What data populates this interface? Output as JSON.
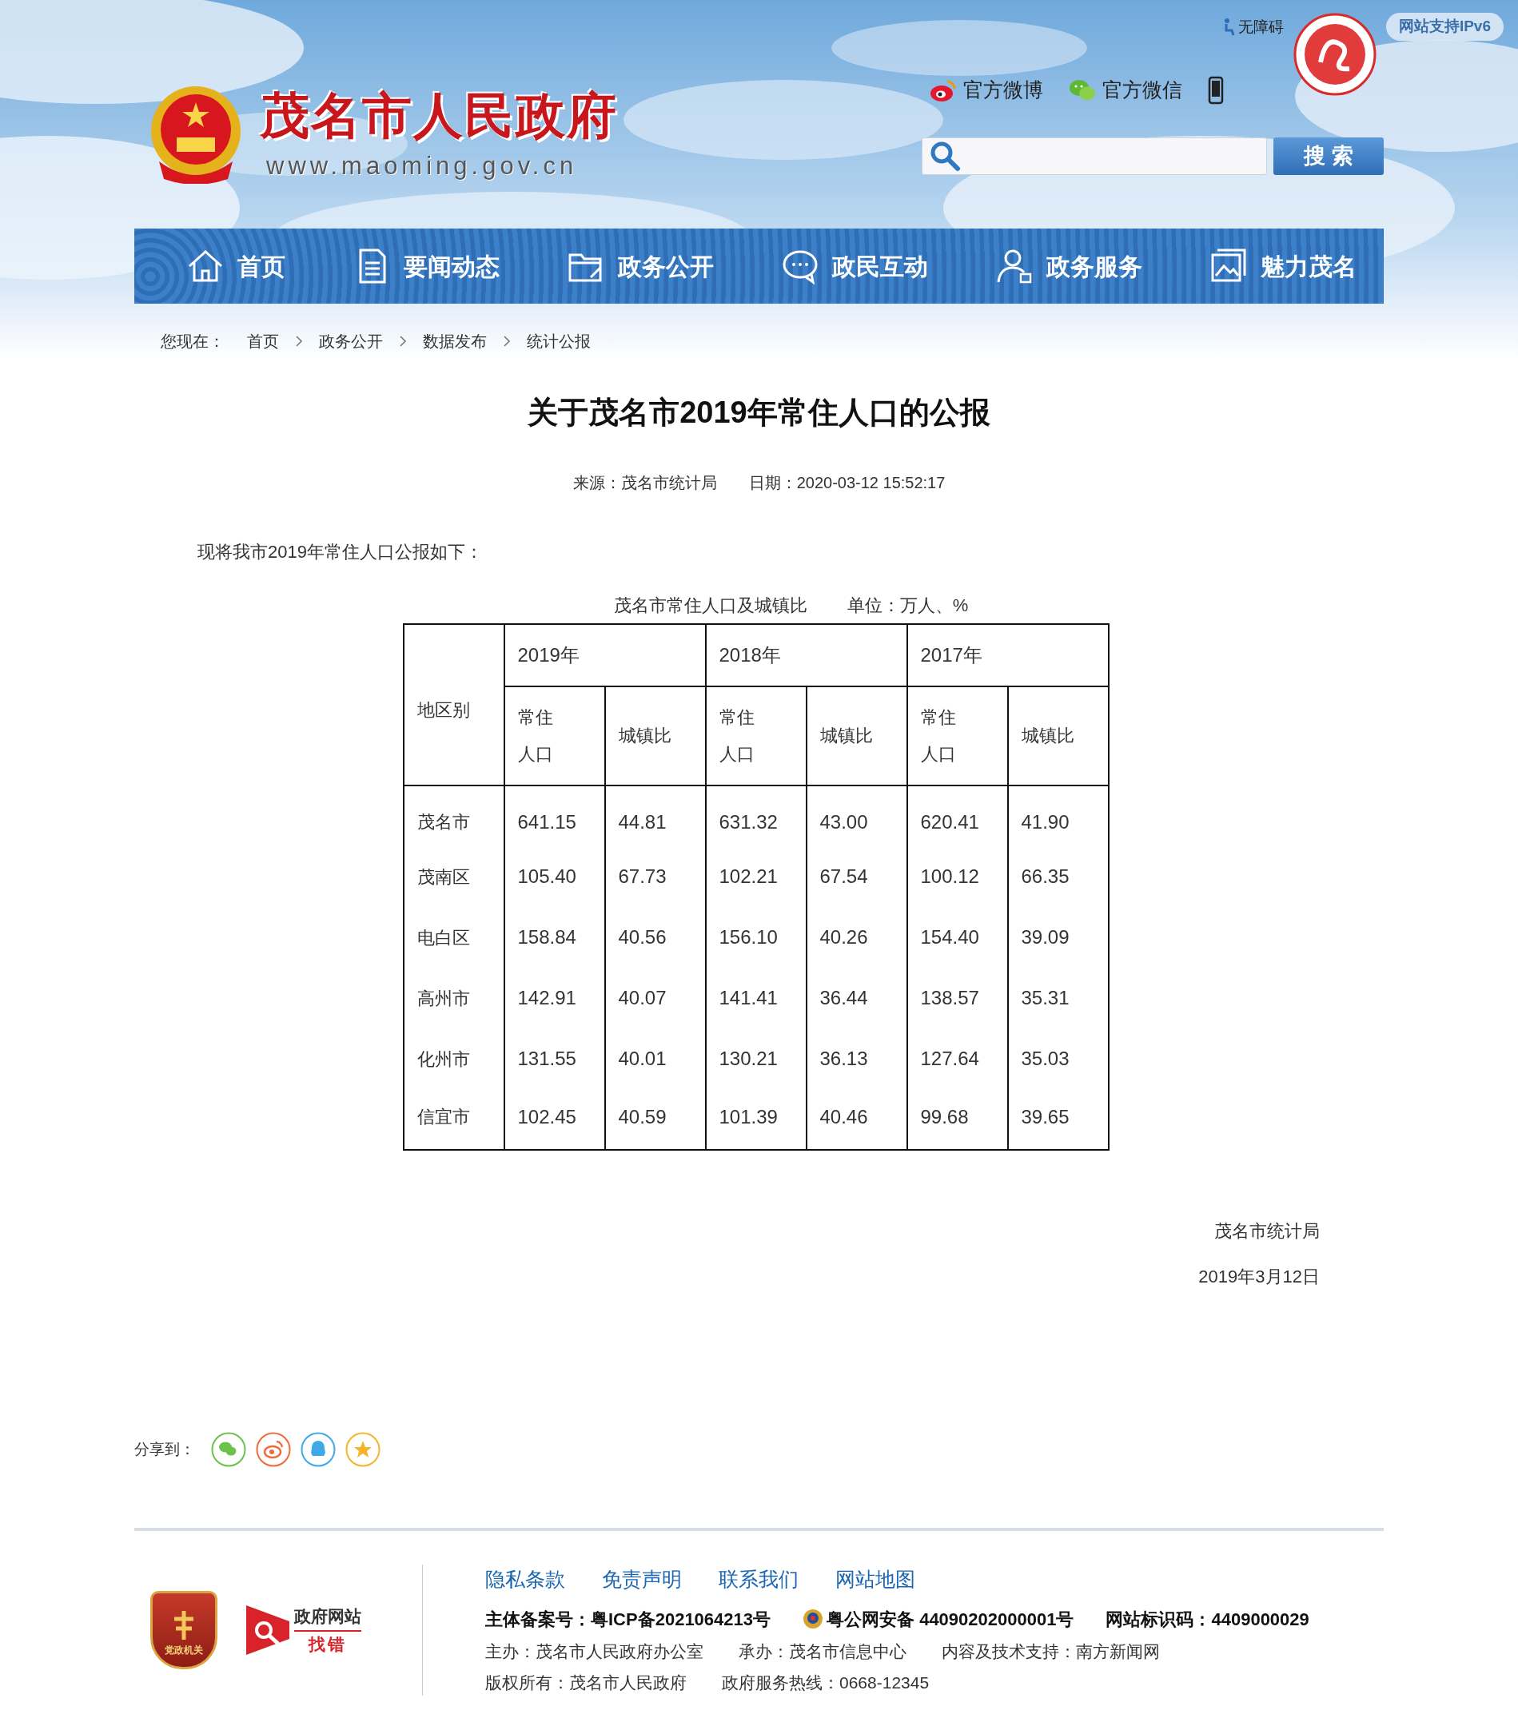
{
  "header": {
    "site_title": "茂名市人民政府",
    "site_url": "www.maoming.gov.cn",
    "accessibility": "无障碍",
    "ipv6_badge": "网站支持IPv6",
    "social": [
      {
        "kind": "weibo",
        "label": "官方微博"
      },
      {
        "kind": "wechat",
        "label": "官方微信"
      },
      {
        "kind": "mobile"
      }
    ],
    "search": {
      "button": "搜 索"
    }
  },
  "nav": [
    {
      "kind": "home",
      "label": "首页"
    },
    {
      "kind": "document",
      "label": "要闻动态"
    },
    {
      "kind": "folder",
      "label": "政务公开"
    },
    {
      "kind": "chat",
      "label": "政民互动"
    },
    {
      "kind": "person",
      "label": "政务服务"
    },
    {
      "label": "魅力茂名"
    }
  ],
  "breadcrumb": {
    "label": "您现在：",
    "items": [
      "首页",
      "政务公开",
      "数据发布",
      "统计公报"
    ]
  },
  "article": {
    "title": "关于茂名市2019年常住人口的公报",
    "source": "来源：茂名市统计局",
    "date": "日期：2020-03-12 15:52:17",
    "intro": "现将我市2019年常住人口公报如下：",
    "table_caption": "茂名市常住人口及城镇比",
    "table_unit": "单位：万人、%",
    "table": {
      "corner": "地区别",
      "years": [
        "2019年",
        "2018年",
        "2017年"
      ],
      "subcolumns": [
        "常住人口",
        "城镇比",
        "常住人口",
        "城镇比",
        "常住人口",
        "城镇比"
      ],
      "rows": [
        [
          "茂名市",
          "641.15",
          "44.81",
          "631.32",
          "43.00",
          "620.41",
          "41.90"
        ],
        [
          "茂南区",
          "105.40",
          "67.73",
          "102.21",
          "67.54",
          "100.12",
          "66.35"
        ],
        [
          "电白区",
          "158.84",
          "40.56",
          "156.10",
          "40.26",
          "154.40",
          "39.09"
        ],
        [
          "高州市",
          "142.91",
          "40.07",
          "141.41",
          "36.44",
          "138.57",
          "35.31"
        ],
        [
          "化州市",
          "131.55",
          "40.01",
          "130.21",
          "36.13",
          "127.64",
          "35.03"
        ],
        [
          "信宜市",
          "102.45",
          "40.59",
          "101.39",
          "40.46",
          "99.68",
          "39.65"
        ]
      ]
    },
    "signature": {
      "org": "茂名市统计局",
      "date": "2019年3月12日"
    }
  },
  "share": {
    "label": "分享到：",
    "items": [
      {
        "kind": "wechat"
      },
      {
        "kind": "weibo"
      },
      {
        "kind": "qq"
      },
      {
        "kind": "favorite"
      }
    ]
  },
  "footer": {
    "badges": {
      "party": "党政机关",
      "report_title": "政府网站",
      "report_action": "找错"
    },
    "links": [
      "隐私条款",
      "免责声明",
      "联系我们",
      "网站地图"
    ],
    "registry": [
      {
        "kind": "text",
        "text": "主体备案号：粤ICP备2021064213号"
      },
      {
        "kind": "police",
        "text": "粤公网安备 44090202000001号"
      },
      {
        "kind": "text",
        "text": "网站标识码：4409000029"
      }
    ],
    "lines": [
      [
        "主办：茂名市人民政府办公室",
        "承办：茂名市信息中心",
        "内容及技术支持：南方新闻网"
      ],
      [
        "版权所有：茂名市人民政府",
        "政府服务热线：0668-12345"
      ]
    ]
  }
}
